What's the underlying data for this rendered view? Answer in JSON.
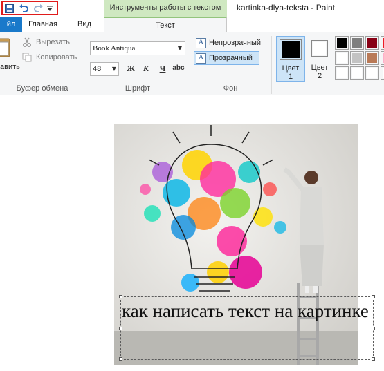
{
  "title_bar": {
    "context_tab": "Инструменты работы с текстом",
    "window_title": "kartinka-dlya-teksta - Paint",
    "qat_icons": [
      "save-icon",
      "undo-icon",
      "redo-icon",
      "customize-qat-icon"
    ]
  },
  "tabs": {
    "file": "йл",
    "home": "Главная",
    "view": "Вид",
    "text": "Текст"
  },
  "clipboard": {
    "paste_label": "авить",
    "cut": "Вырезать",
    "copy": "Копировать",
    "group": "Буфер обмена"
  },
  "font": {
    "family": "Book Antiqua",
    "size": "48",
    "bold": "Ж",
    "italic": "К",
    "underline": "Ч",
    "strike": "abc",
    "group": "Шрифт"
  },
  "background": {
    "opaque": "Непрозрачный",
    "transparent": "Прозрачный",
    "group": "Фон",
    "selected": "transparent"
  },
  "colors": {
    "color1_label": "Цвет",
    "color1_num": "1",
    "color2_label": "Цвет",
    "color2_num": "2",
    "color1": "#000000",
    "color2": "#ffffff",
    "palette": [
      "#000000",
      "#7f7f7f",
      "#880015",
      "#ed1c24",
      "#ffffff",
      "#c3c3c3",
      "#b97a57",
      "#ffaec9",
      "#ffffff",
      "#ffffff",
      "#ffffff",
      "#ffffff"
    ]
  },
  "canvas": {
    "text": "как написать текст на картинке"
  }
}
